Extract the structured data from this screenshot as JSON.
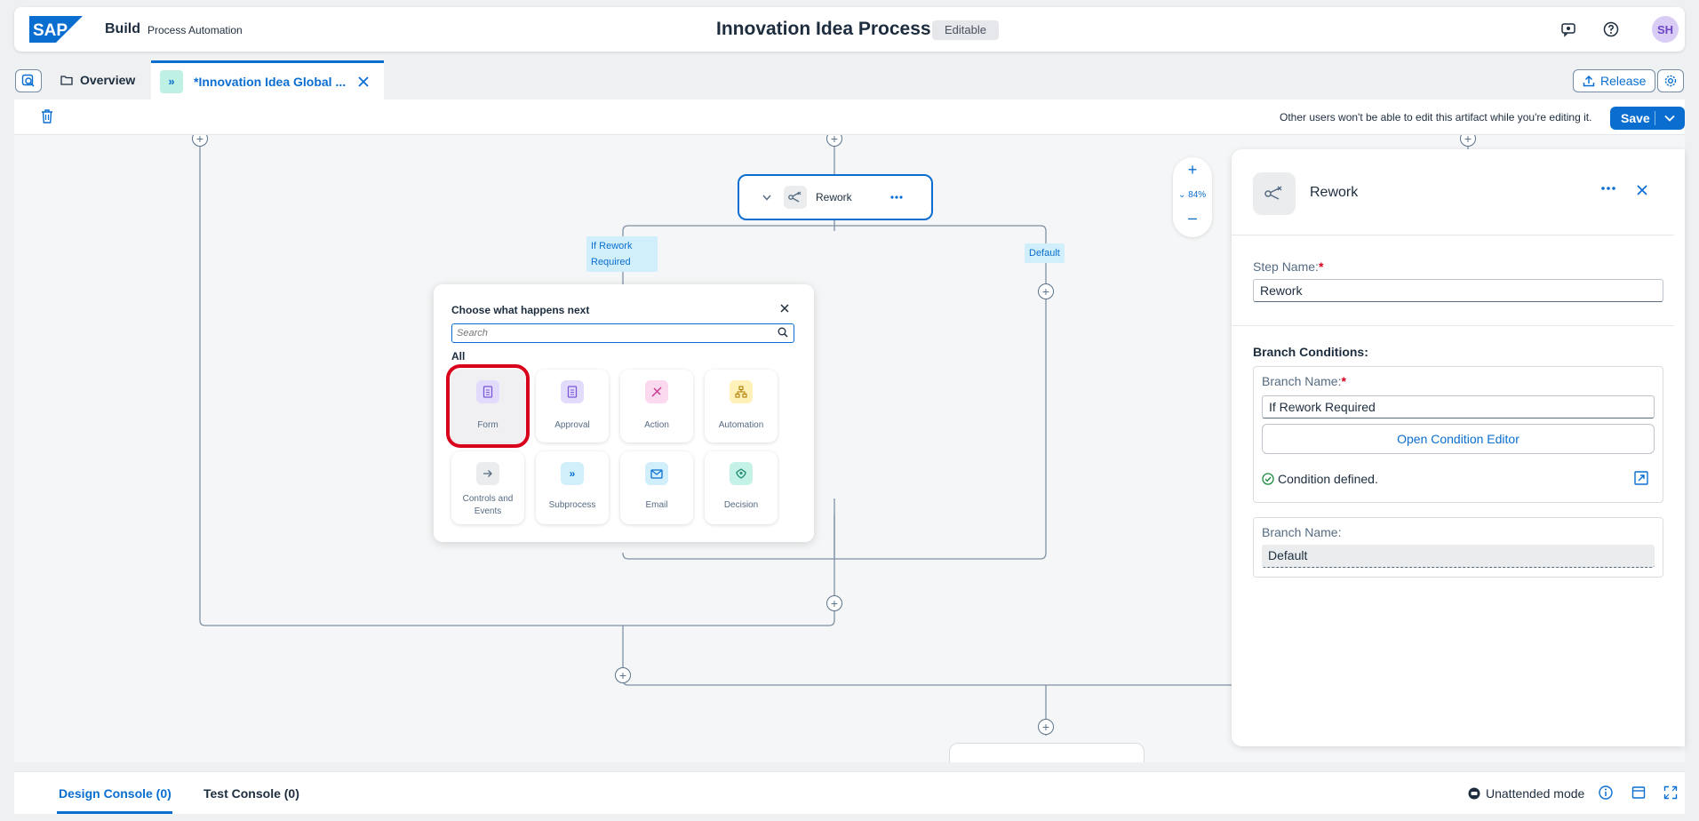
{
  "shell": {
    "logo": "SAP",
    "brand": "Build",
    "product": "Process Automation",
    "title": "Innovation Idea Process",
    "badge": "Editable",
    "avatar_initials": "SH"
  },
  "tabs": {
    "overview": "Overview",
    "active_tab": "*Innovation Idea Global ...",
    "release": "Release"
  },
  "toolbar": {
    "lock_message": "Other users won't be able to edit this artifact while you're editing it.",
    "save": "Save"
  },
  "canvas": {
    "node_label": "Rework",
    "branch_1": "If Rework Required",
    "branch_2": "Default",
    "zoom": "84%"
  },
  "popover": {
    "title": "Choose what happens next",
    "search_placeholder": "Search",
    "group": "All",
    "tiles": [
      {
        "label": "Form",
        "icon": "form-icon",
        "color": "#e3dbfb"
      },
      {
        "label": "Approval",
        "icon": "approval-icon",
        "color": "#e3dbfb"
      },
      {
        "label": "Action",
        "icon": "action-icon",
        "color": "#fbd9ef"
      },
      {
        "label": "Automation",
        "icon": "automation-icon",
        "color": "#fff1b8"
      },
      {
        "label": "Controls and Events",
        "icon": "arrow-right-icon",
        "color": "#eaecee"
      },
      {
        "label": "Subprocess",
        "icon": "subprocess-icon",
        "color": "#d1effa"
      },
      {
        "label": "Email",
        "icon": "email-icon",
        "color": "#d1effa"
      },
      {
        "label": "Decision",
        "icon": "decision-icon",
        "color": "#c5f2e6"
      }
    ],
    "selected_tile": "Form"
  },
  "panel": {
    "title": "Rework",
    "step_name_label": "Step Name:",
    "step_name_value": "Rework",
    "branch_conditions_title": "Branch Conditions:",
    "branch_name_label": "Branch Name:",
    "branch_1_value": "If Rework Required",
    "open_condition_editor": "Open Condition Editor",
    "condition_status": "Condition defined.",
    "branch_2_value": "Default"
  },
  "console": {
    "design_tab": "Design Console (0)",
    "test_tab": "Test Console (0)",
    "mode": "Unattended mode"
  },
  "colors": {
    "accent": "#0a6ed1",
    "highlight": "#d9001b"
  }
}
